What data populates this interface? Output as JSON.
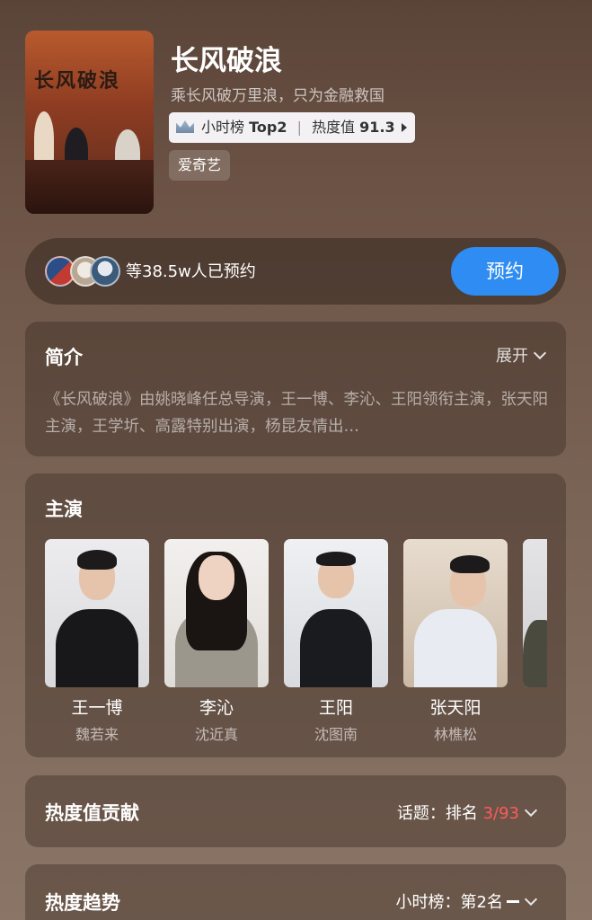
{
  "show": {
    "poster_title": "长风破浪",
    "title": "长风破浪",
    "subtitle": "乘长风破万里浪，只为金融救国",
    "rank_label": "小时榜",
    "rank_value": "Top2",
    "heat_label": "热度值",
    "heat_value": "91.3",
    "platform": "爱奇艺"
  },
  "reserve": {
    "text": "等38.5w人已预约",
    "button": "预约"
  },
  "intro": {
    "title": "简介",
    "expand": "展开",
    "text": "《长风破浪》由姚晓峰任总导演，王一博、李沁、王阳领衔主演，张天阳主演，王学圻、高露特别出演，杨昆友情出…"
  },
  "cast": {
    "title": "主演",
    "items": [
      {
        "name": "王一博",
        "role": "魏若来"
      },
      {
        "name": "李沁",
        "role": "沈近真"
      },
      {
        "name": "王阳",
        "role": "沈图南"
      },
      {
        "name": "张天阳",
        "role": "林樵松"
      }
    ]
  },
  "contribution": {
    "title": "热度值贡献",
    "label": "话题：排名",
    "rank": "3/93"
  },
  "trend": {
    "title": "热度趋势",
    "label": "小时榜：第2名"
  },
  "colors": {
    "accent": "#2f8cf2",
    "rank_red": "#ff5a5a"
  }
}
